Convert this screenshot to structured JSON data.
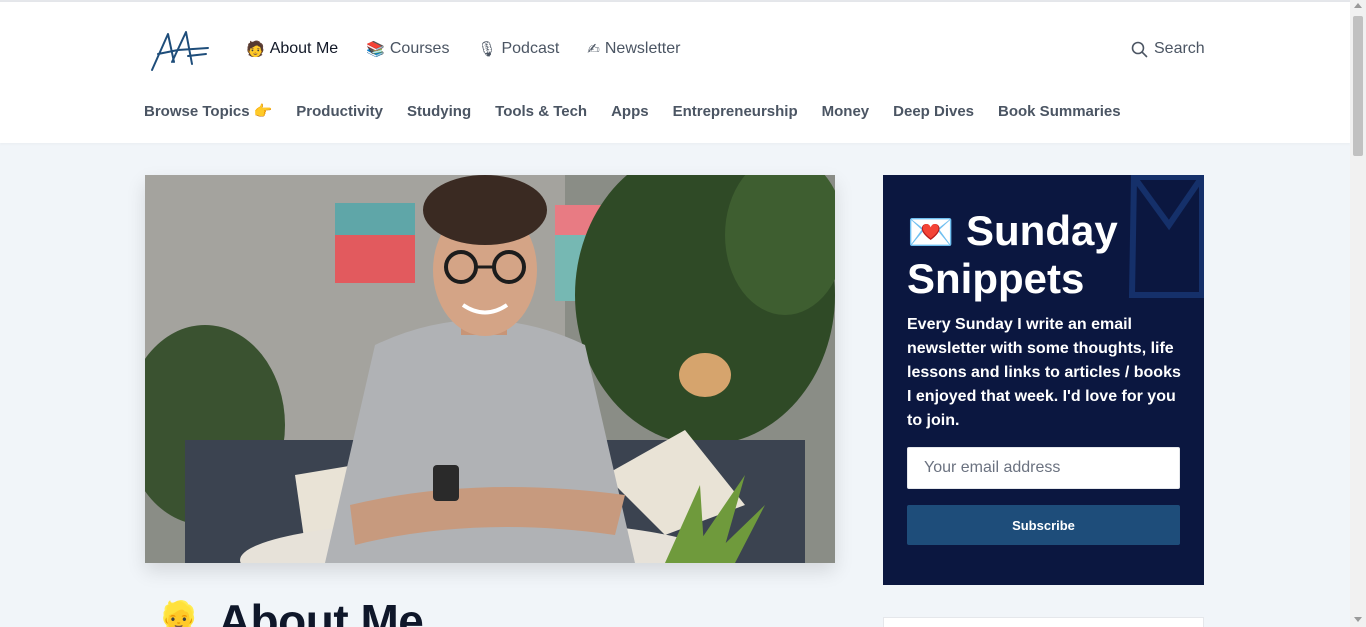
{
  "header": {
    "logo_icon": "aa-signature-logo",
    "nav": [
      {
        "label": "About Me",
        "icon": "person-icon",
        "emoji": "🧑",
        "active": true
      },
      {
        "label": "Courses",
        "icon": "books-icon",
        "emoji": "📚",
        "active": false
      },
      {
        "label": "Podcast",
        "icon": "microphone-icon",
        "emoji": "🎙",
        "active": false
      },
      {
        "label": "Newsletter",
        "icon": "writing-hand-icon",
        "emoji": "✍",
        "active": false
      }
    ],
    "search_label": "Search",
    "topics": [
      {
        "label": "Browse Topics",
        "emoji": "👉"
      },
      {
        "label": "Productivity"
      },
      {
        "label": "Studying"
      },
      {
        "label": "Tools & Tech"
      },
      {
        "label": "Apps"
      },
      {
        "label": "Entrepreneurship"
      },
      {
        "label": "Money"
      },
      {
        "label": "Deep Dives"
      },
      {
        "label": "Book Summaries"
      }
    ]
  },
  "hero": {
    "image": "smiling-man-photo"
  },
  "about": {
    "emoji": "👱",
    "title": "About Me"
  },
  "newsletter": {
    "emoji": "💌",
    "title": "Sunday Snippets",
    "description": "Every Sunday I write an email newsletter with some thoughts, life lessons and links to articles / books I enjoyed that week. I'd love for you to join.",
    "email_placeholder": "Your email address",
    "button_label": "Subscribe",
    "background": "#0b1740",
    "button_color": "#1e4d7a"
  }
}
